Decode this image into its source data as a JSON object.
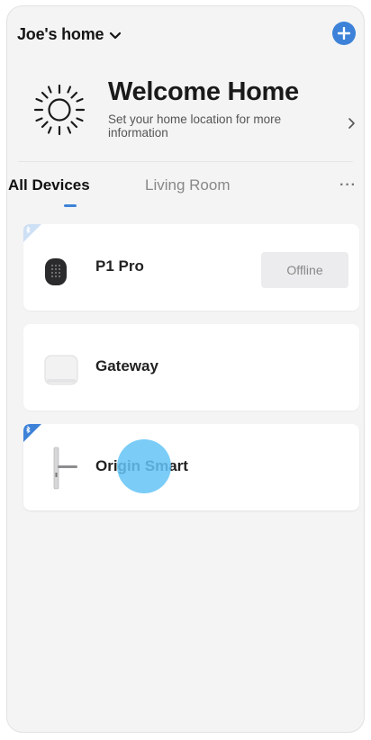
{
  "header": {
    "home_name": "Joe's  home",
    "add_label": "+"
  },
  "welcome": {
    "title": "Welcome Home",
    "subtitle": "Set your home location for more information"
  },
  "tabs": {
    "items": [
      {
        "label": "All Devices",
        "active": true
      },
      {
        "label": "Living Room",
        "active": false
      }
    ],
    "more_label": "···"
  },
  "devices": [
    {
      "name": "P1 Pro",
      "status": "Offline",
      "bluetooth": true,
      "icon": "keypad-lock-icon"
    },
    {
      "name": "Gateway",
      "bluetooth": false,
      "icon": "gateway-icon"
    },
    {
      "name": "Origin Smart",
      "bluetooth": true,
      "icon": "door-handle-icon"
    }
  ],
  "colors": {
    "accent": "#3d82d8",
    "touch": "#64c4f7"
  }
}
